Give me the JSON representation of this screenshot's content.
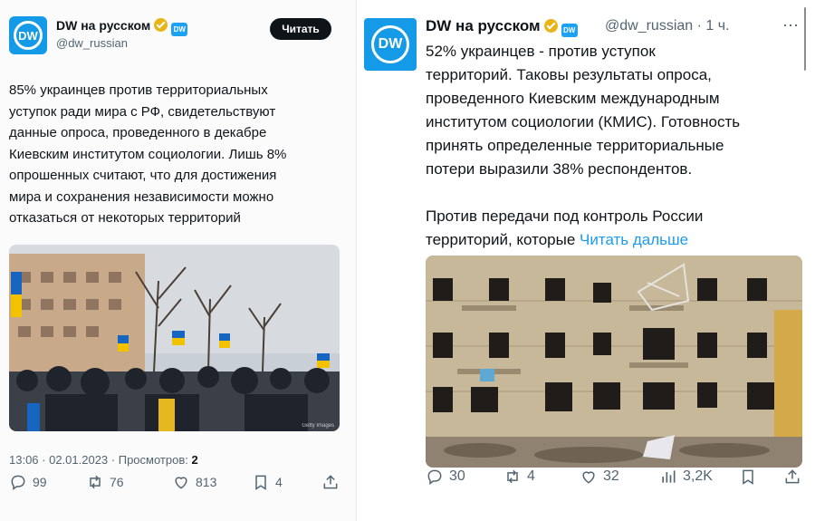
{
  "left_tweet": {
    "author_name": "DW на русском",
    "author_handle": "@dw_russian",
    "avatar_text": "DW",
    "badge_text": "DW",
    "follow_label": "Читать",
    "text": "85% украинцев против территориальных\nуступок ради мира с РФ, свидетельствуют\nданные опроса, проведенного в декабре\nКиевским институтом социологии. Лишь 8%\nопрошенных считают, что для достижения\nмира и сохранения независимости можно\nотказаться от некоторых территорий",
    "timestamp": "13:06 · 02.01.2023",
    "views_label": "Просмотров:",
    "views_value": "2",
    "photo_watermark": "Getty Images",
    "stats": {
      "replies": "99",
      "retweets": "76",
      "likes": "813",
      "shares": "4"
    }
  },
  "right_tweet": {
    "author_name": "DW на русском",
    "author_handle": "@dw_russian",
    "time_ago": "· 1 ч.",
    "avatar_text": "DW",
    "badge_text": "DW",
    "text": "52% украинцев - против уступок\nтерриторий. Таковы результаты опроса,\nпроведенного Киевским международным\nинститутом социологии (КМИС). Готовность\nпринять определенные территориальные\nпотери выразили 38% респондентов.\n\nПротив передачи под контроль России\nтерриторий, которые ",
    "more_link": "Читать дальше",
    "stats": {
      "replies": "30",
      "retweets": "4",
      "likes": "32",
      "views": "3,2K"
    }
  },
  "colors": {
    "brand": "#149ae6",
    "link": "#1d9bf0",
    "text": "#0f1419",
    "muted": "#536471",
    "verified": "#e8b518"
  },
  "icons": [
    "reply-icon",
    "retweet-icon",
    "like-icon",
    "views-icon",
    "bookmark-icon",
    "share-icon",
    "verified-icon"
  ]
}
